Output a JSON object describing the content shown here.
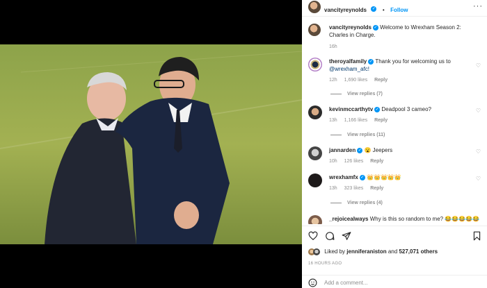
{
  "post": {
    "author": "vancityreynolds",
    "follow_label": "Follow",
    "dot": "•",
    "more_label": "···",
    "caption": "Welcome to Wrexham Season 2: Charles in Charge.",
    "caption_age": "16h"
  },
  "comments": [
    {
      "user": "theroyalfamily",
      "text": "Thank you for welcoming us to",
      "mention": "@wrexham_afc!",
      "age": "12h",
      "likes": "1,690 likes",
      "reply": "Reply",
      "view_replies": "View replies (7)"
    },
    {
      "user": "kevinmccarthytv",
      "text": "Deadpool 3 cameo?",
      "age": "13h",
      "likes": "1,166 likes",
      "reply": "Reply",
      "view_replies": "View replies (11)"
    },
    {
      "user": "jannarden",
      "text": "😮 Jeepers",
      "age": "10h",
      "likes": "126 likes",
      "reply": "Reply"
    },
    {
      "user": "wrexhamfx",
      "text": "👑👑👑👑👑",
      "age": "13h",
      "likes": "323 likes",
      "reply": "Reply",
      "view_replies": "View replies (4)"
    },
    {
      "user": "_rejoicealways",
      "text": "Why is this so random to me? 😂😂😂😂😂"
    }
  ],
  "footer": {
    "liked_by": "Liked by",
    "liked_user": "jenniferaniston",
    "and": "and",
    "others": "527,071 others",
    "timestamp": "16 HOURS AGO",
    "add_comment_placeholder": "Add a comment..."
  },
  "colors": {
    "accent": "#0095f6",
    "muted": "#8e8e8e",
    "text": "#262626"
  }
}
